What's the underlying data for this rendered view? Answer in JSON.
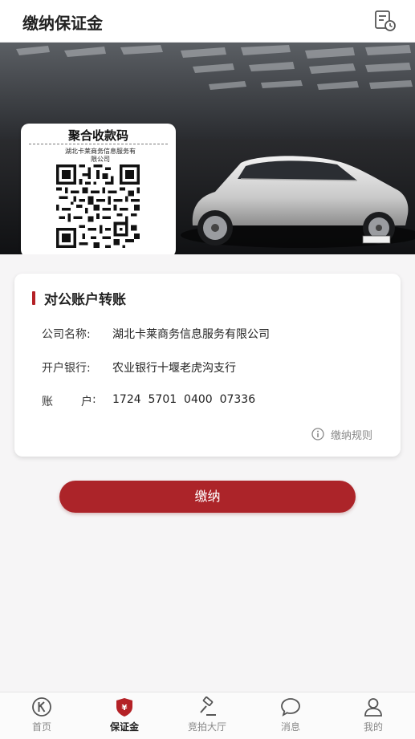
{
  "header": {
    "title": "缴纳保证金",
    "history_icon": "record-clock-icon"
  },
  "banner": {
    "qr_card": {
      "title": "聚合收款码",
      "company": "湖北卡莱商务信息服务有限公司"
    },
    "plate_text": "BB·Z 961"
  },
  "account_card": {
    "title": "对公账户转账",
    "company_label": "公司名称:",
    "company_value": "湖北卡莱商务信息服务有限公司",
    "bank_label": "开户银行:",
    "bank_value": "农业银行十堰老虎沟支行",
    "account_label_1": "账",
    "account_label_2": "户",
    "account_colon": ":",
    "account_value": "1724  5701  0400  07336",
    "rules_label": "缴纳规则",
    "rules_icon": "info-icon"
  },
  "pay_button": {
    "label": "缴纳"
  },
  "tabbar": {
    "items": [
      {
        "label": "首页",
        "icon": "home-k-icon",
        "active": false
      },
      {
        "label": "保证金",
        "icon": "deposit-shield-icon",
        "active": true
      },
      {
        "label": "竞拍大厅",
        "icon": "auction-hammer-icon",
        "active": false
      },
      {
        "label": "消息",
        "icon": "message-bubble-icon",
        "active": false
      },
      {
        "label": "我的",
        "icon": "user-icon",
        "active": false
      }
    ]
  },
  "colors": {
    "accent": "#ac2429",
    "active_tab_icon": "#b42126",
    "inactive_tab": "#888888"
  }
}
